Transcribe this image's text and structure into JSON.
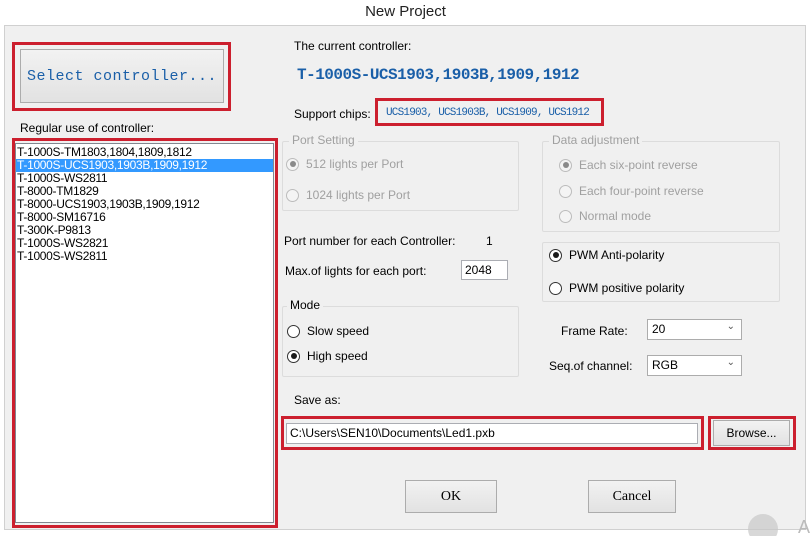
{
  "window": {
    "title": "New Project"
  },
  "select_controller": {
    "label": "Select controller..."
  },
  "regular_use": {
    "label": "Regular use of controller:",
    "items": [
      "T-1000S-TM1803,1804,1809,1812",
      "T-1000S-UCS1903,1903B,1909,1912",
      "T-1000S-WS2811",
      "T-8000-TM1829",
      "T-8000-UCS1903,1903B,1909,1912",
      "T-8000-SM16716",
      "T-300K-P9813",
      "T-1000S-WS2821",
      "T-1000S-WS2811"
    ],
    "selected_index": 1
  },
  "current_controller": {
    "label": "The current controller:",
    "value": "T-1000S-UCS1903,1903B,1909,1912"
  },
  "support_chips": {
    "label": "Support chips:",
    "value": "UCS1903, UCS1903B, UCS1909, UCS1912"
  },
  "port_setting": {
    "legend": "Port Setting",
    "options": [
      "512 lights per Port",
      "1024 lights per Port"
    ],
    "selected_index": 0,
    "enabled": false
  },
  "data_adjustment": {
    "legend": "Data adjustment",
    "options": [
      "Each six-point reverse",
      "Each four-point reverse",
      "Normal mode"
    ],
    "selected_index": 0,
    "enabled": false
  },
  "polarity": {
    "options": [
      "PWM Anti-polarity",
      "PWM positive polarity"
    ],
    "selected_index": 0
  },
  "port_number": {
    "label": "Port number for each Controller:",
    "value": "1"
  },
  "max_lights": {
    "label": "Max.of lights for each port:",
    "value": "2048"
  },
  "mode": {
    "legend": "Mode",
    "options": [
      "Slow speed",
      "High speed"
    ],
    "selected_index": 1
  },
  "frame_rate": {
    "label": "Frame Rate:",
    "value": "20"
  },
  "seq_channel": {
    "label": "Seq.of channel:",
    "value": "RGB"
  },
  "save_as": {
    "label": "Save as:",
    "value": "C:\\Users\\SEN10\\Documents\\Led1.pxb",
    "browse_label": "Browse..."
  },
  "footer": {
    "ok_label": "OK",
    "cancel_label": "Cancel"
  },
  "colors": {
    "highlight_red": "#cc1f2e",
    "accent_blue": "#1a5fa8",
    "selection_blue": "#3399ff"
  }
}
